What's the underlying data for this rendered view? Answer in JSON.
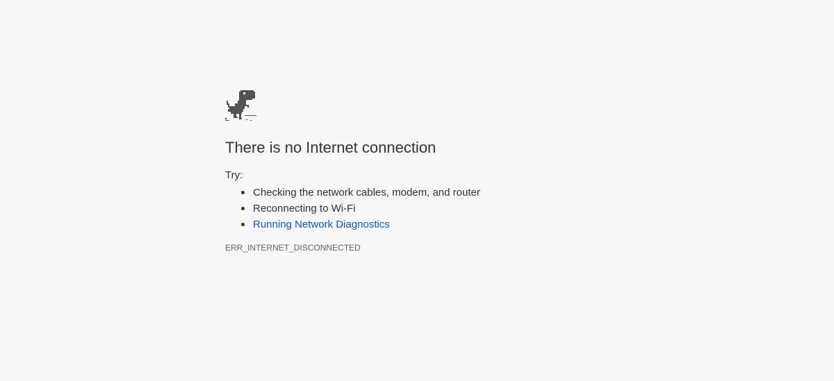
{
  "page": {
    "icon": "offline-dinosaur-icon",
    "heading": "There is no Internet connection",
    "try_label": "Try:",
    "suggestions": [
      {
        "label": "Checking the network cables, modem, and router",
        "link": false
      },
      {
        "label": "Reconnecting to Wi-Fi",
        "link": false
      },
      {
        "label": "Running Network Diagnostics",
        "link": true
      }
    ],
    "error_code": "ERR_INTERNET_DISCONNECTED"
  },
  "colors": {
    "background": "#f7f7f7",
    "text": "#333333",
    "link": "#1155cc",
    "error_code": "#646464",
    "dino": "#535353"
  }
}
